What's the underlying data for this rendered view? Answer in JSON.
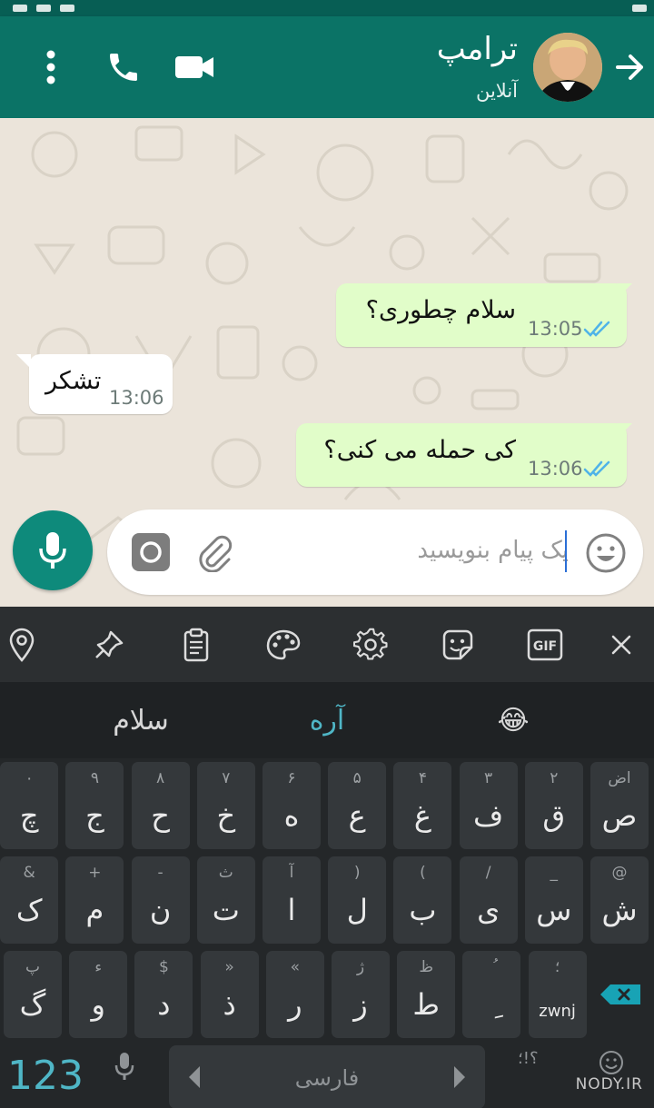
{
  "header": {
    "contact_name": "ترامپ",
    "contact_status": "آنلاین"
  },
  "messages": [
    {
      "direction": "out",
      "text": "سلام چطوری؟",
      "time": "13:05",
      "read": true
    },
    {
      "direction": "in",
      "text": "تشکر",
      "time": "13:06"
    },
    {
      "direction": "out",
      "text": "کی حمله می کنی؟",
      "time": "13:06",
      "read": true
    }
  ],
  "composer": {
    "placeholder": "یک پیام بنویسید"
  },
  "keyboard": {
    "toolbar": [
      "location-icon",
      "pin-icon",
      "clipboard-icon",
      "palette-icon",
      "settings-icon",
      "sticker-icon",
      "gif-icon",
      "close-icon"
    ],
    "gif_label": "GIF",
    "suggestions": [
      "سلام",
      "آره",
      "😂"
    ],
    "rows": [
      [
        {
          "hint": "اض",
          "main": "ص"
        },
        {
          "hint": "٢",
          "main": "ق"
        },
        {
          "hint": "٣",
          "main": "ف"
        },
        {
          "hint": "۴",
          "main": "غ"
        },
        {
          "hint": "۵",
          "main": "ع"
        },
        {
          "hint": "۶",
          "main": "ه"
        },
        {
          "hint": "٧",
          "main": "خ"
        },
        {
          "hint": "٨",
          "main": "ح"
        },
        {
          "hint": "٩",
          "main": "ج"
        },
        {
          "hint": "٠",
          "main": "چ"
        }
      ],
      [
        {
          "hint": "@",
          "main": "ش"
        },
        {
          "hint": "_",
          "main": "س"
        },
        {
          "hint": "/",
          "main": "ی"
        },
        {
          "hint": "(",
          "main": "ب"
        },
        {
          "hint": ")",
          "main": "ل"
        },
        {
          "hint": "آ",
          "main": "ا"
        },
        {
          "hint": "ث",
          "main": "ت"
        },
        {
          "hint": "-",
          "main": "ن"
        },
        {
          "hint": "+",
          "main": "م"
        },
        {
          "hint": "&",
          "main": "ک"
        }
      ],
      [
        {
          "hint": "؛",
          "main": "zwnj"
        },
        {
          "hint": "ُ",
          "main": "ِ"
        },
        {
          "hint": "ظ",
          "main": "ط"
        },
        {
          "hint": "ژ",
          "main": "ز"
        },
        {
          "hint": "«",
          "main": "ر"
        },
        {
          "hint": "»",
          "main": "ذ"
        },
        {
          "hint": "$",
          "main": "د"
        },
        {
          "hint": "ء",
          "main": "و"
        },
        {
          "hint": "پ",
          "main": "گ"
        }
      ]
    ],
    "num_label": "123",
    "language_label": "فارسی",
    "punct_label": "؟!؛"
  },
  "watermark": "NODY.IR",
  "colors": {
    "header_bg": "#0b7366",
    "out_bubble": "#e1fdc9",
    "in_bubble": "#ffffff",
    "read_ticks": "#4fb3e8",
    "mic_bg": "#0e8a7b",
    "accent_blue": "#4fb6c6"
  }
}
